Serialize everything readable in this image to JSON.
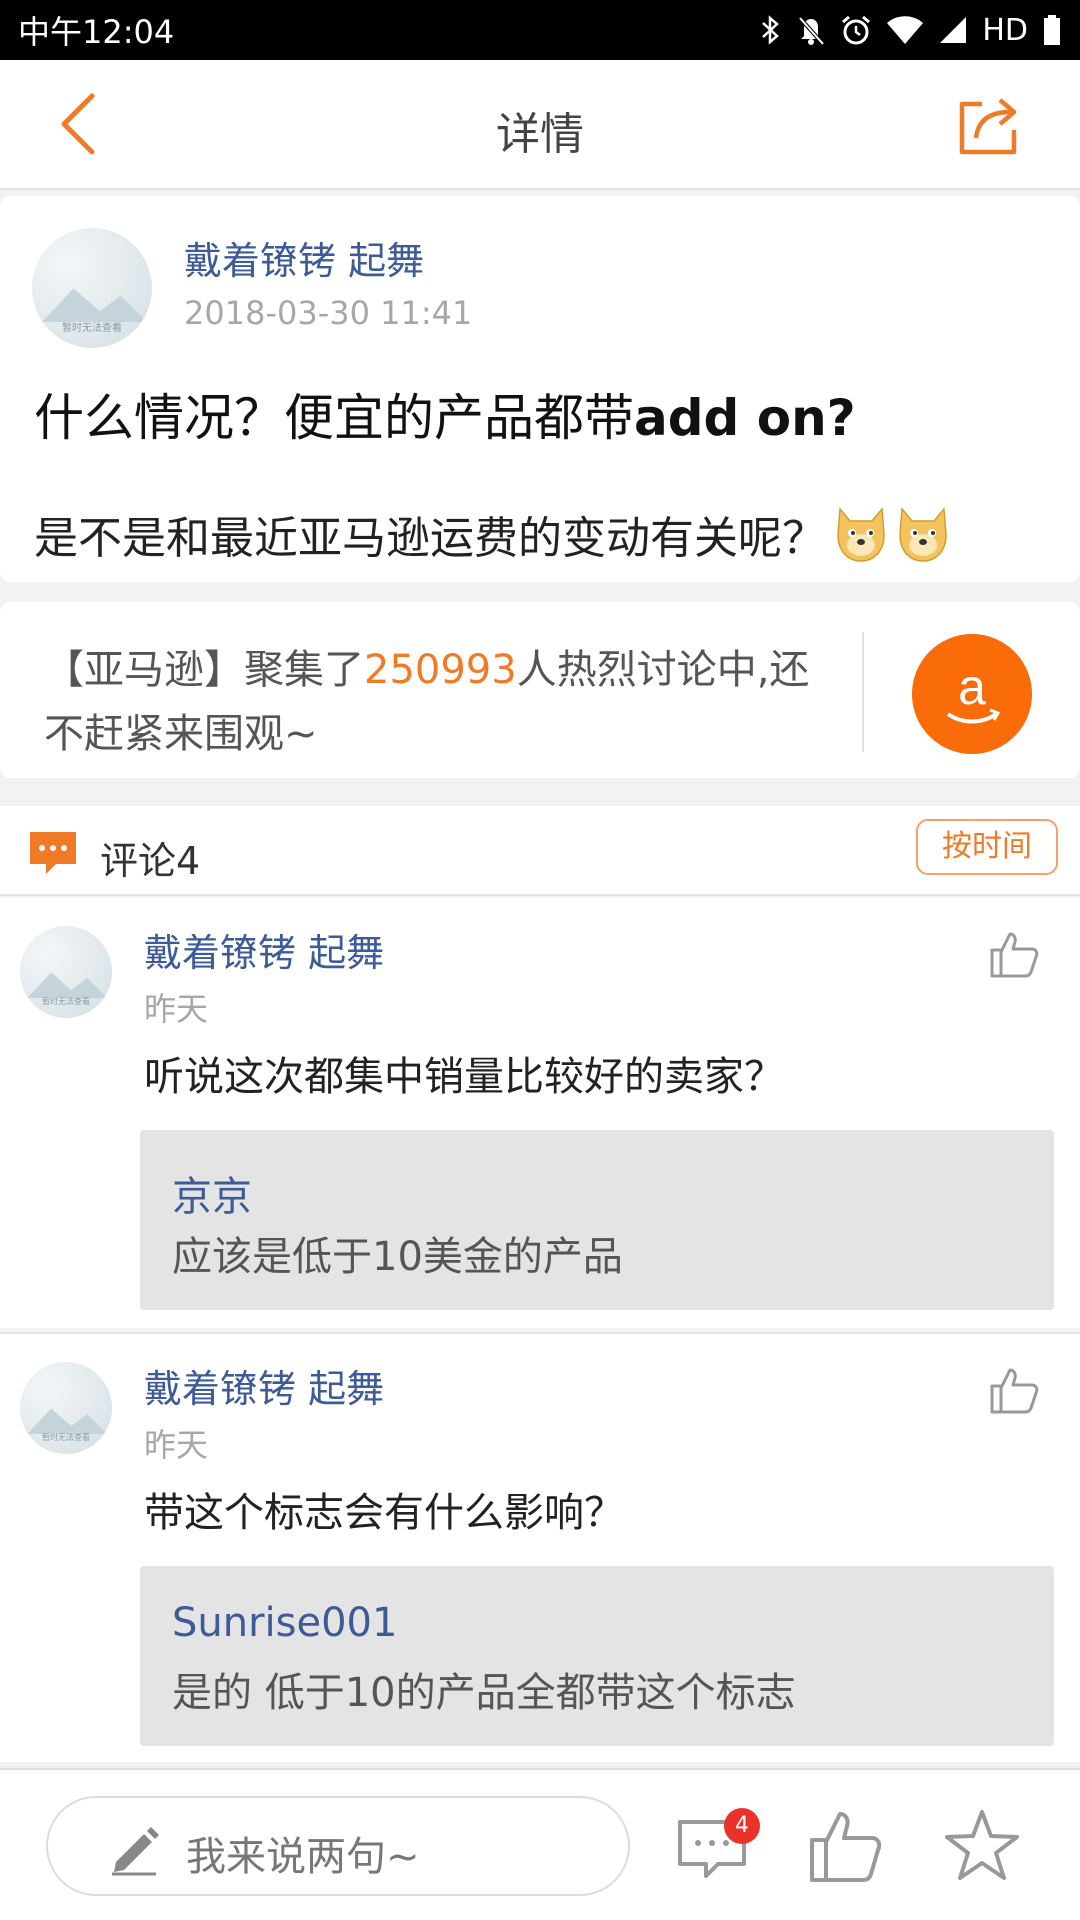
{
  "status_bar": {
    "time": "中午12:04",
    "network": "HD"
  },
  "nav": {
    "title": "详情"
  },
  "post": {
    "author": "戴着镣铐 起舞",
    "avatar_text": "暂时无法查看",
    "time": "2018-03-30 11:41",
    "title_cn": "什么情况？便宜的产品都带",
    "title_en": "add on?",
    "body": "是不是和最近亚马逊运费的变动有关呢？"
  },
  "topic": {
    "prefix": "【亚马逊】聚集了",
    "count": "250993",
    "suffix": "人热烈讨论中,还不赶紧来围观~",
    "icon": "amazon-logo-icon",
    "accent": "#fa6b0a"
  },
  "comments_header": {
    "label": "评论4",
    "sort_label": "按时间"
  },
  "comments": [
    {
      "author": "戴着镣铐 起舞",
      "avatar_text": "暂时无法查看",
      "time": "昨天",
      "text": "听说这次都集中销量比较好的卖家？",
      "reply": {
        "author": "京京",
        "text": "应该是低于10美金的产品"
      }
    },
    {
      "author": "戴着镣铐 起舞",
      "avatar_text": "暂时无法查看",
      "time": "昨天",
      "text": "带这个标志会有什么影响？",
      "reply": {
        "author": "Sunrise001",
        "text": "是的 低于10的产品全都带这个标志"
      }
    }
  ],
  "bottom_bar": {
    "placeholder": "我来说两句~",
    "comment_badge": "4"
  },
  "colors": {
    "accent": "#f07a26",
    "link": "#3d5a99",
    "badge": "#e8322a"
  }
}
